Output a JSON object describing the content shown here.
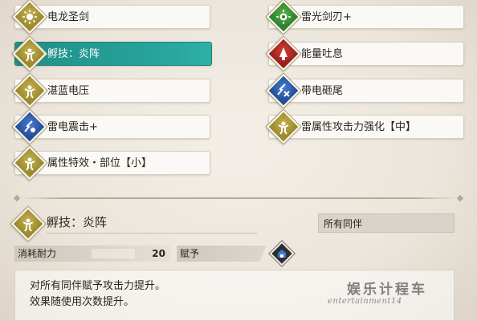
{
  "skills_left": [
    {
      "label": "电龙圣剑",
      "icon": "olive-diamond-icon",
      "selected": false
    },
    {
      "label": "孵技：炎阵",
      "icon": "olive-diamond-icon",
      "selected": true
    },
    {
      "label": "湛蓝电压",
      "icon": "olive-diamond-icon",
      "selected": false
    },
    {
      "label": "雷电震击+",
      "icon": "blue-diamond-icon",
      "selected": false
    },
    {
      "label": "属性特效・部位【小】",
      "icon": "olive-diamond-icon",
      "selected": false
    }
  ],
  "skills_right": [
    {
      "label": "雷光剑刃+",
      "icon": "green-diamond-icon",
      "selected": false
    },
    {
      "label": "能量吐息",
      "icon": "red-diamond-icon",
      "selected": false
    },
    {
      "label": "带电砸尾",
      "icon": "blue-diamond-icon",
      "selected": false
    },
    {
      "label": "雷属性攻击力强化【中】",
      "icon": "olive-diamond-icon",
      "selected": false
    }
  ],
  "detail": {
    "title": "孵技：炎阵",
    "target": "所有同伴",
    "cost_label": "消耗耐力",
    "cost_value": "20",
    "grant_label": "赋予",
    "description": [
      "对所有同伴赋予攻击力提升。",
      "效果随使用次数提升。"
    ]
  },
  "watermark": {
    "line1": "娱乐计程车",
    "line2": "entertainment14"
  },
  "colors": {
    "selected": "#27a39b",
    "olive": "#9b8a2e",
    "green": "#2f8230",
    "red": "#9b1f1c",
    "blue": "#234f9b"
  }
}
